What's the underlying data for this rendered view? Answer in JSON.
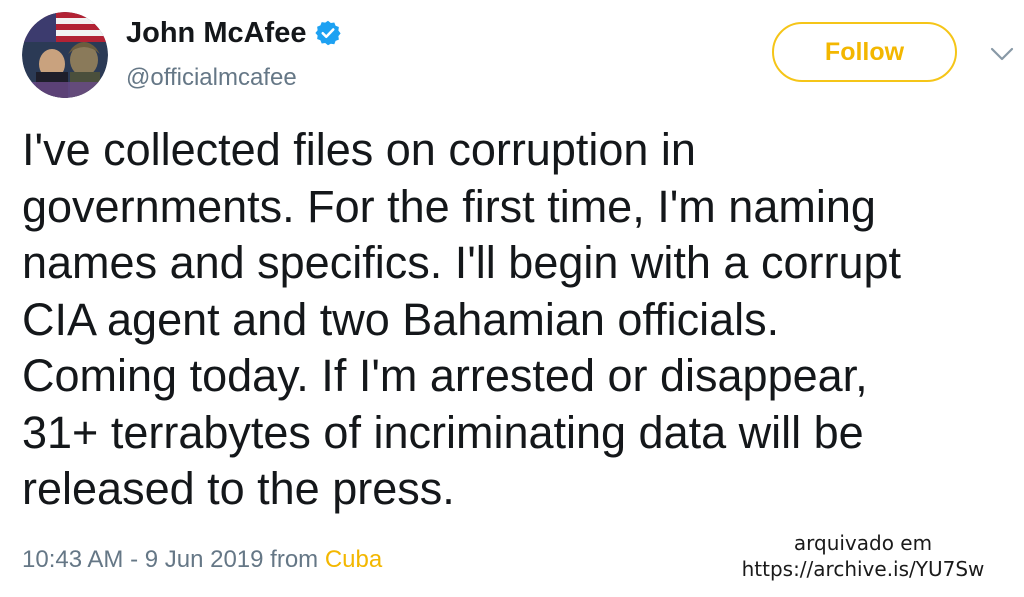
{
  "user": {
    "display_name": "John McAfee",
    "handle": "@officialmcafee",
    "verified": true
  },
  "header": {
    "follow_label": "Follow"
  },
  "tweet": {
    "lines": [
      "I've collected files on corruption in",
      "governments. For the first time, I'm naming",
      "names and specifics. I'll begin with a corrupt",
      "CIA agent and two Bahamian officials.",
      "Coming today. If I'm arrested or disappear,",
      "31+ terrabytes of incriminating data will be",
      "released to the press."
    ]
  },
  "meta": {
    "time_date": "10:43 AM - 9 Jun 2019",
    "from_label": " from ",
    "source": "Cuba"
  },
  "archive": {
    "line1": "arquivado em",
    "line2": "https://archive.is/YU7Sw"
  },
  "colors": {
    "accent": "#f3b700",
    "verified": "#1da1f2",
    "secondary_text": "#657786"
  },
  "icons": {
    "verified": "verified-badge-icon",
    "chevron": "chevron-down-icon",
    "avatar": "profile-avatar"
  }
}
